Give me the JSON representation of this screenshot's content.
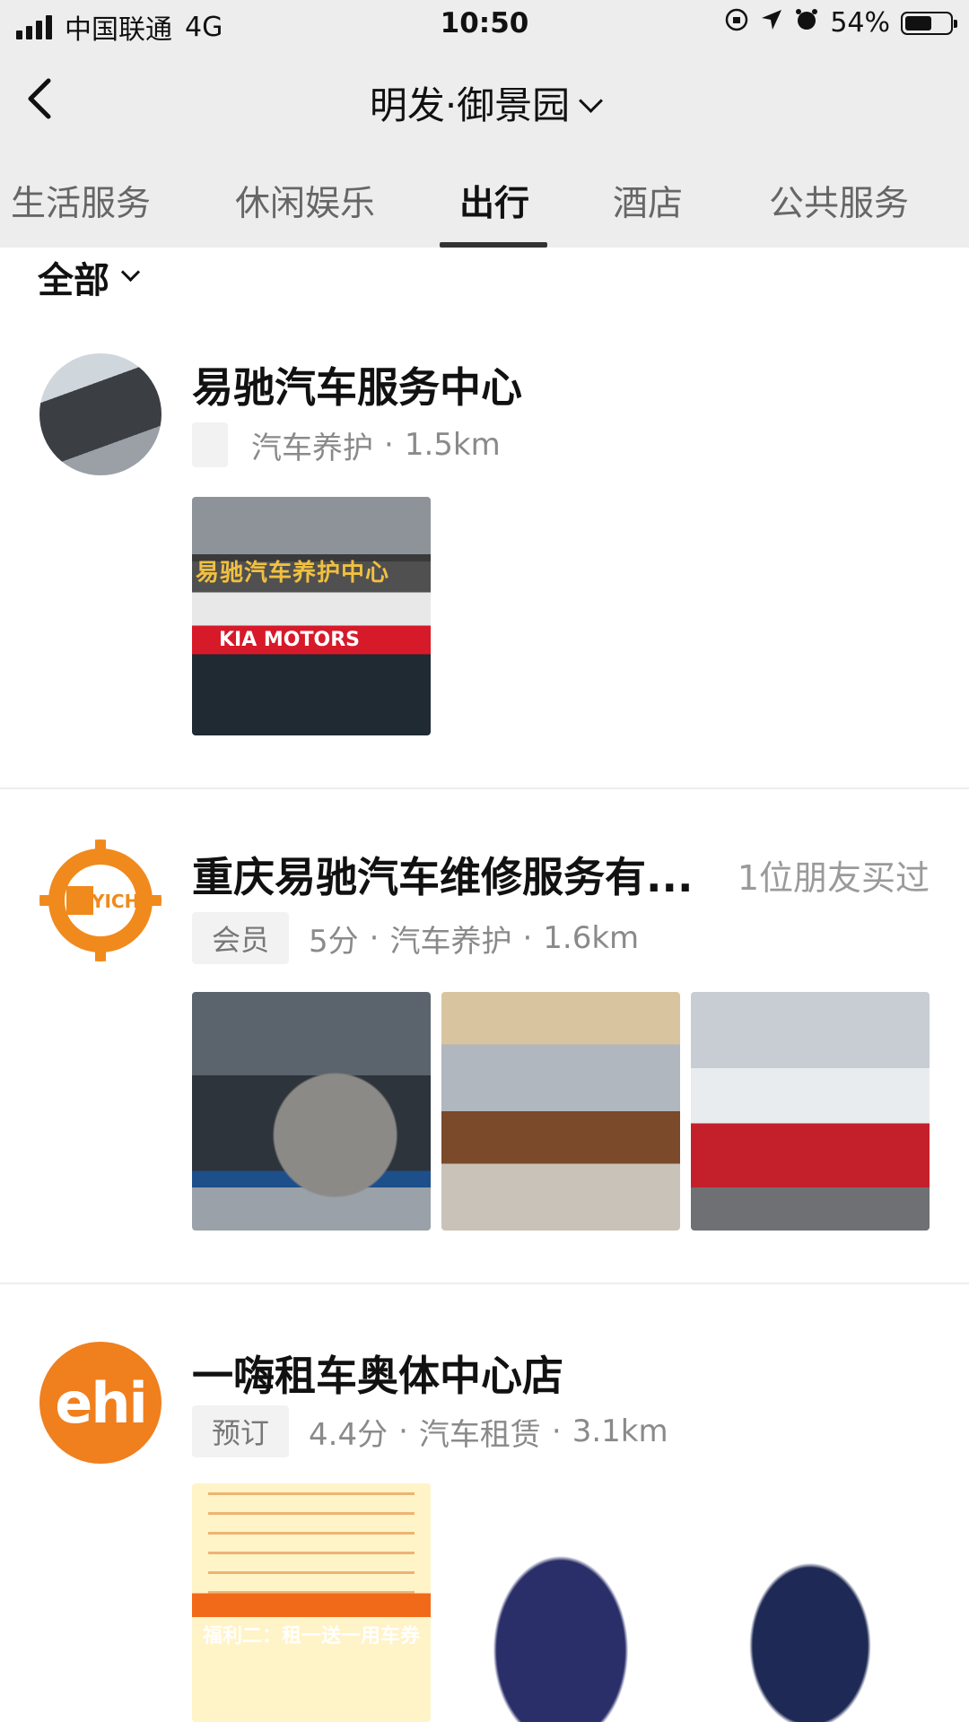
{
  "status_bar": {
    "carrier": "中国联通",
    "network": "4G",
    "time": "10:50",
    "battery": "54%",
    "battery_level": 0.54,
    "icons": [
      "signal-icon",
      "rotation-lock-icon",
      "location-arrow-icon",
      "alarm-icon",
      "battery-icon"
    ]
  },
  "nav": {
    "title": "明发·御景园",
    "back_icon": "chevron-left-icon",
    "dropdown_icon": "chevron-down-icon"
  },
  "tabs": [
    {
      "label": "生活服务",
      "active": false
    },
    {
      "label": "休闲娱乐",
      "active": false
    },
    {
      "label": "出行",
      "active": true
    },
    {
      "label": "酒店",
      "active": false
    },
    {
      "label": "公共服务",
      "active": false
    }
  ],
  "filter": {
    "label": "全部"
  },
  "items": [
    {
      "name": "易驰汽车服务中心",
      "friends": "",
      "tag": "",
      "score": "",
      "category": "汽车养护",
      "distance": "1.5km",
      "photos": [
        "storefront"
      ],
      "photo_text": {
        "sign": "易驰汽车养护中心",
        "brand": "KIA MOTORS"
      }
    },
    {
      "name": "重庆易驰汽车维修服务有...",
      "friends": "1位朋友买过",
      "tag": "会员",
      "score": "5分",
      "category": "汽车养护",
      "distance": "1.6km",
      "logo_text": "YICHI",
      "photos": [
        "garage",
        "lobby",
        "service-bay"
      ]
    },
    {
      "name": "一嗨租车奥体中心店",
      "friends": "",
      "tag": "预订",
      "score": "4.4分",
      "category": "汽车租赁",
      "distance": "3.1km",
      "logo_text": "ehi",
      "photos": [
        "promo-poster",
        "suv",
        "sedan"
      ],
      "photo_text": {
        "poster_title": "福利二：租一送一用车券"
      }
    }
  ],
  "colors": {
    "bar_bg": "#ededed",
    "ehi_orange": "#f07f1e",
    "yichi_orange": "#f08a1c"
  }
}
